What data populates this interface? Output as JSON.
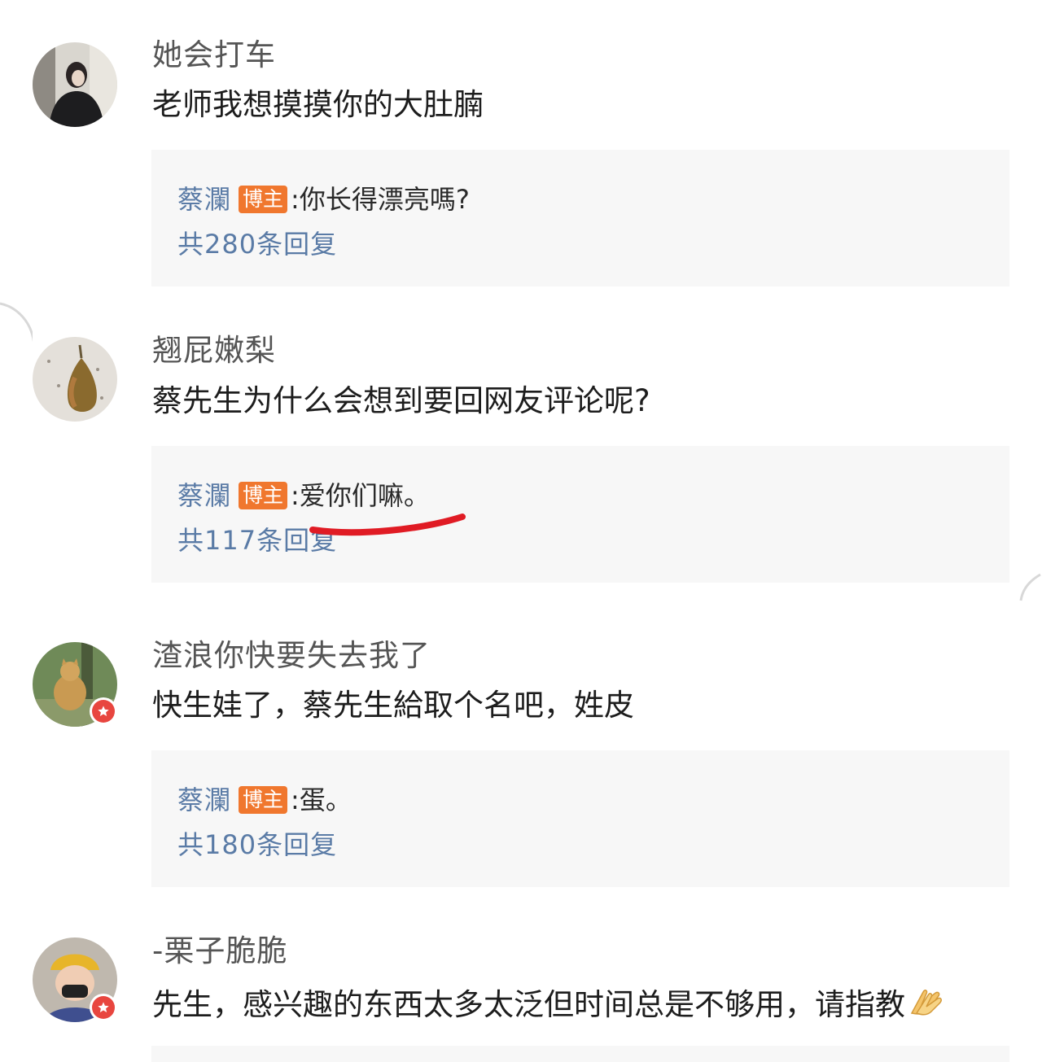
{
  "comments": [
    {
      "username": "她会打车",
      "content": "老师我想摸摸你的大肚腩",
      "reply": {
        "author": "蔡瀾",
        "tag": "博主",
        "separator": ":",
        "text": " 你长得漂亮嗎?",
        "count": "共280条回复"
      }
    },
    {
      "username": "翘屁嫩梨",
      "content": "蔡先生为什么会想到要回网友评论呢?",
      "reply": {
        "author": "蔡瀾",
        "tag": "博主",
        "separator": ":",
        "text": " 爱你们嘛。",
        "count": "共117条回复"
      }
    },
    {
      "username": "渣浪你快要失去我了",
      "content": "快生娃了，蔡先生給取个名吧，姓皮",
      "reply": {
        "author": "蔡瀾",
        "tag": "博主",
        "separator": ":",
        "text": " 蛋。",
        "count": "共180条回复"
      }
    },
    {
      "username": "-栗子脆脆",
      "content": "先生，感兴趣的东西太多太泛但时间总是不够用，请指教",
      "emoji": "praying-hands-icon"
    }
  ],
  "colors": {
    "link_blue": "#5a7ba6",
    "owner_tag": "#f0772e",
    "vip_badge": "#e8463f",
    "highlight_underline": "#e01b24"
  }
}
